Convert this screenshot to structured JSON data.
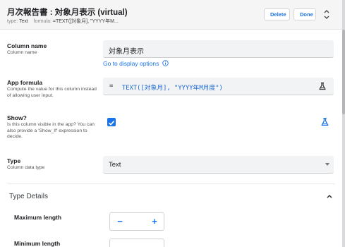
{
  "header": {
    "title": "月次報告書 : 対象月表示 (virtual)",
    "type_key": "type:",
    "type_value": "Text",
    "formula_key": "formula:",
    "formula_value": "=TEXT([対象月], \"YYYY年M...",
    "delete_label": "Delete",
    "done_label": "Done"
  },
  "column_name": {
    "label": "Column name",
    "description": "Column name",
    "value": "対象月表示",
    "display_link": "Go to display options"
  },
  "app_formula": {
    "label": "App formula",
    "description": "Compute the value for this column instead of allowing user input.",
    "equals": "=",
    "value": "TEXT([対象月], \"YYYY年M月度\")"
  },
  "show": {
    "label": "Show?",
    "description": "Is this column visible in the app? You can also provide a 'Show_If' expression to decide.",
    "checked": true
  },
  "type": {
    "label": "Type",
    "description": "Column data type",
    "value": "Text"
  },
  "type_details": {
    "title": "Type Details",
    "maximum_length_label": "Maximum length",
    "minimum_length_label": "Minimum length",
    "minus": "−",
    "plus": "+"
  },
  "colors": {
    "accent": "#1a73e8",
    "header_bg": "#f5f5f5"
  }
}
